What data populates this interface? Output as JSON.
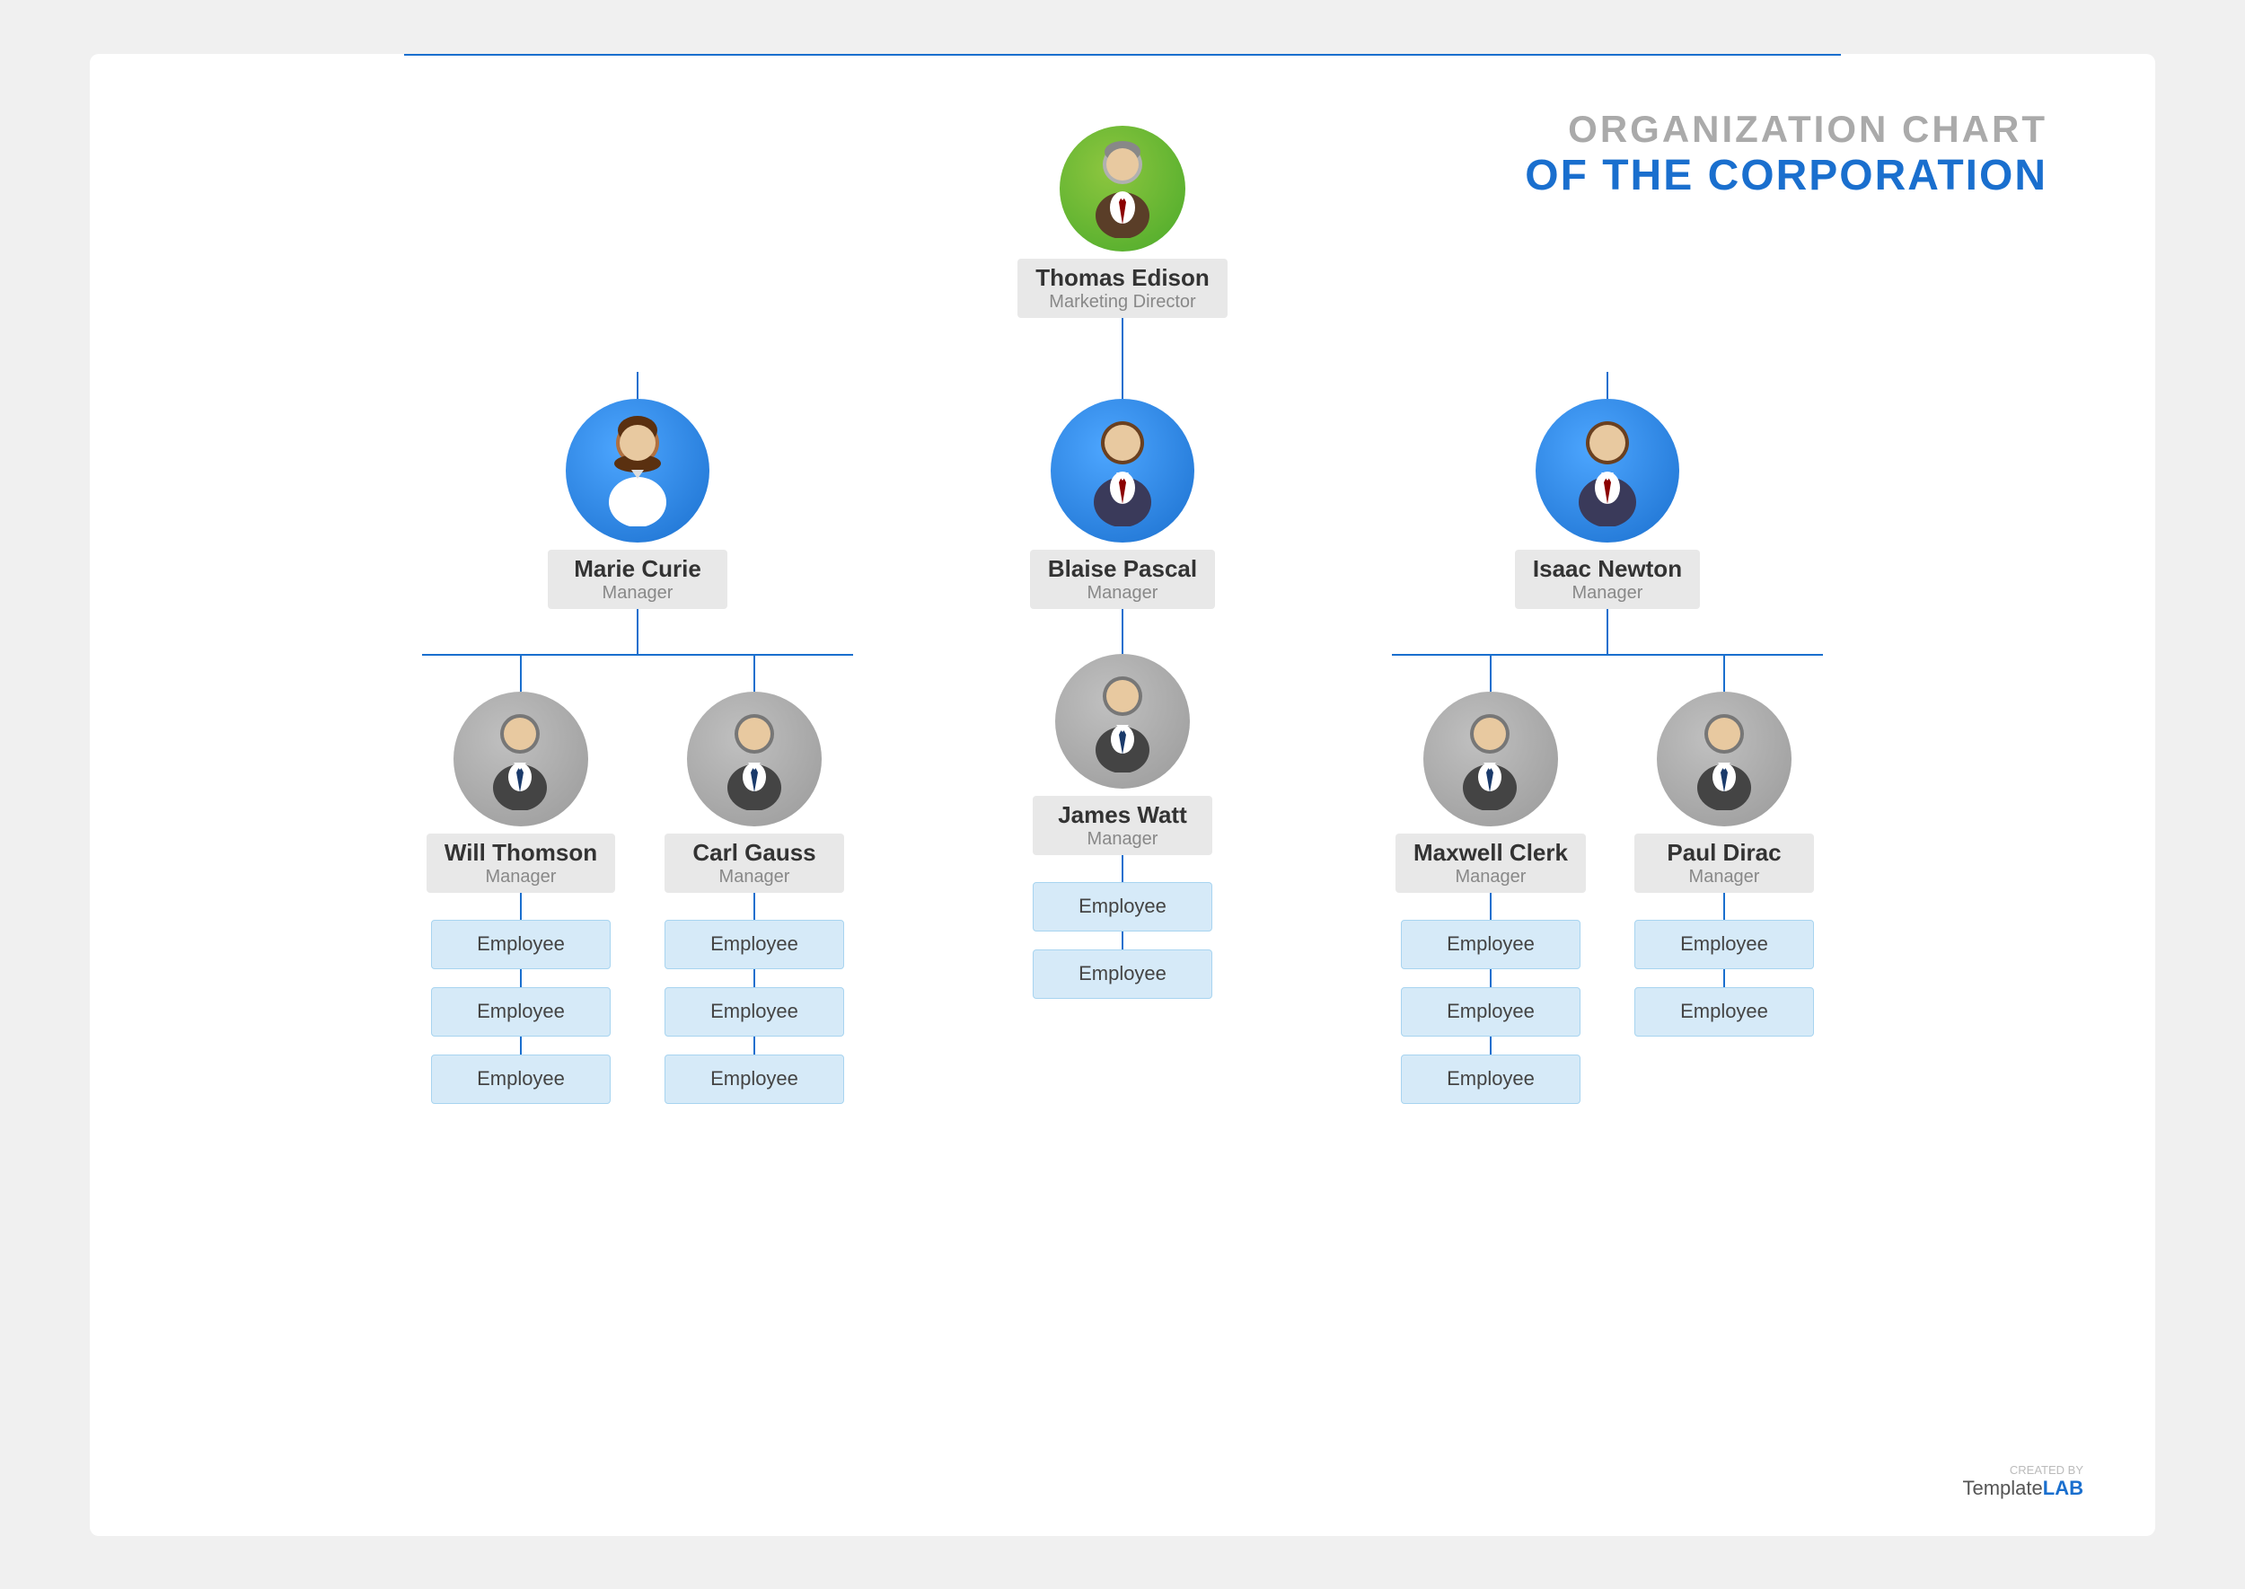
{
  "title": {
    "line1": "ORGANIZATION CHART",
    "line2": "OF THE CORPORATION"
  },
  "watermark": {
    "created_by": "CREATED BY",
    "template": "Template",
    "lab": "LAB"
  },
  "root": {
    "name": "Thomas Edison",
    "role": "Marketing Director",
    "avatar_type": "green"
  },
  "level2": [
    {
      "name": "Marie Curie",
      "role": "Manager",
      "avatar_type": "blue",
      "gender": "female"
    },
    {
      "name": "Blaise Pascal",
      "role": "Manager",
      "avatar_type": "blue",
      "gender": "male"
    },
    {
      "name": "Isaac Newton",
      "role": "Manager",
      "avatar_type": "blue",
      "gender": "male"
    }
  ],
  "level3": [
    {
      "parent": 0,
      "children": [
        {
          "name": "Will Thomson",
          "role": "Manager",
          "avatar_type": "gray"
        },
        {
          "name": "Carl Gauss",
          "role": "Manager",
          "avatar_type": "gray"
        }
      ]
    },
    {
      "parent": 1,
      "children": [
        {
          "name": "James Watt",
          "role": "Manager",
          "avatar_type": "gray"
        }
      ]
    },
    {
      "parent": 2,
      "children": [
        {
          "name": "Maxwell Clerk",
          "role": "Manager",
          "avatar_type": "gray"
        },
        {
          "name": "Paul Dirac",
          "role": "Manager",
          "avatar_type": "gray"
        }
      ]
    }
  ],
  "employees": {
    "will_thomson": [
      "Employee",
      "Employee",
      "Employee"
    ],
    "carl_gauss": [
      "Employee",
      "Employee",
      "Employee"
    ],
    "james_watt": [
      "Employee",
      "Employee"
    ],
    "maxwell_clerk": [
      "Employee",
      "Employee",
      "Employee"
    ],
    "paul_dirac": [
      "Employee",
      "Employee"
    ]
  },
  "employee_label": "Employee"
}
